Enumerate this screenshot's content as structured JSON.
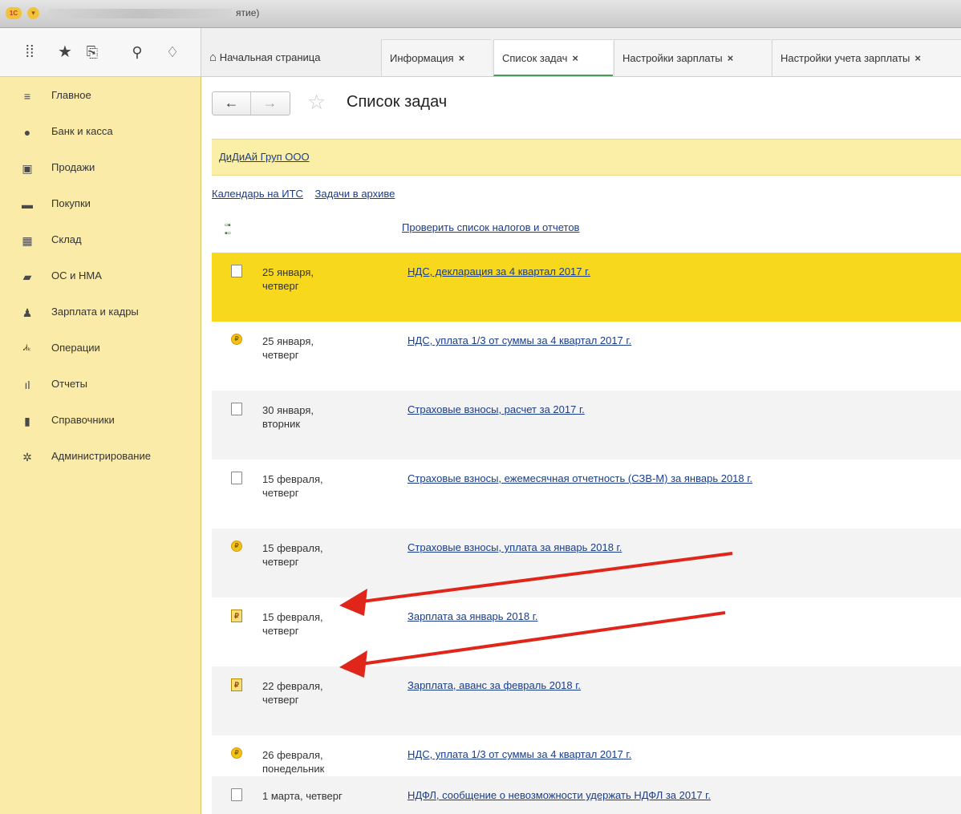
{
  "window": {
    "title": "ятие)",
    "logo_text": "1С"
  },
  "toolbar": {
    "icons": [
      "apps-grid-icon",
      "favorites-star-icon",
      "history-icon",
      "search-icon",
      "bell-icon"
    ]
  },
  "tabs": [
    {
      "label": "Начальная страница",
      "closable": false,
      "active": false
    },
    {
      "label": "Информация",
      "closable": true,
      "active": false
    },
    {
      "label": "Список задач",
      "closable": true,
      "active": true
    },
    {
      "label": "Настройки зарплаты",
      "closable": true,
      "active": false
    },
    {
      "label": "Настройки учета зарплаты",
      "closable": true,
      "active": false
    }
  ],
  "tab_close_glyph": "×",
  "sidebar": {
    "items": [
      {
        "label": "Главное",
        "icon": "menu-lines-icon"
      },
      {
        "label": "Банк и касса",
        "icon": "coin-icon"
      },
      {
        "label": "Продажи",
        "icon": "bag-icon"
      },
      {
        "label": "Покупки",
        "icon": "cart-icon"
      },
      {
        "label": "Склад",
        "icon": "warehouse-icon"
      },
      {
        "label": "ОС и НМА",
        "icon": "truck-icon"
      },
      {
        "label": "Зарплата и кадры",
        "icon": "person-icon"
      },
      {
        "label": "Операции",
        "icon": "operations-icon"
      },
      {
        "label": "Отчеты",
        "icon": "bar-chart-icon"
      },
      {
        "label": "Справочники",
        "icon": "book-icon"
      },
      {
        "label": "Администрирование",
        "icon": "gear-icon"
      }
    ]
  },
  "main": {
    "title": "Список задач",
    "organization": "ДиДиАй Груп ООО",
    "links": [
      "Календарь на ИТС",
      "Задачи в архиве"
    ],
    "check_link": "Проверить список налогов и отчетов",
    "tasks": [
      {
        "date1": "25 января,",
        "date2": "четверг",
        "title": "НДС, декларация за 4 квартал 2017 г.",
        "icon": "document-icon",
        "highlight": true
      },
      {
        "date1": "25 января,",
        "date2": "четверг",
        "title": "НДС, уплата 1/3 от суммы за 4 квартал 2017 г.",
        "icon": "payment-coin-icon",
        "highlight": false
      },
      {
        "date1": "30 января,",
        "date2": "вторник",
        "title": "Страховые взносы, расчет за 2017 г.",
        "icon": "document-icon",
        "highlight": false
      },
      {
        "date1": "15 февраля,",
        "date2": "четверг",
        "title": "Страховые взносы, ежемесячная отчетность (СЗВ-М) за январь 2018 г.",
        "icon": "document-icon",
        "highlight": false
      },
      {
        "date1": "15 февраля,",
        "date2": "четверг",
        "title": "Страховые взносы, уплата за январь 2018 г.",
        "icon": "payment-coin-icon",
        "highlight": false
      },
      {
        "date1": "15 февраля,",
        "date2": "четверг",
        "title": "Зарплата за январь 2018 г.",
        "icon": "payroll-icon",
        "highlight": false
      },
      {
        "date1": "22 февраля,",
        "date2": "четверг",
        "title": "Зарплата, аванс за февраль 2018 г.",
        "icon": "payroll-icon",
        "highlight": false
      },
      {
        "date1": "26 февраля,",
        "date2": "понедельник",
        "title": "НДС, уплата 1/3 от суммы за 4 квартал 2017 г.",
        "icon": "payment-coin-icon",
        "highlight": false
      },
      {
        "date1": "1 марта, четверг",
        "date2": "",
        "title": "НДФЛ, сообщение о невозможности удержать НДФЛ за 2017 г.",
        "icon": "document-icon",
        "highlight": false
      }
    ]
  },
  "annotation_color": "#e0251b"
}
